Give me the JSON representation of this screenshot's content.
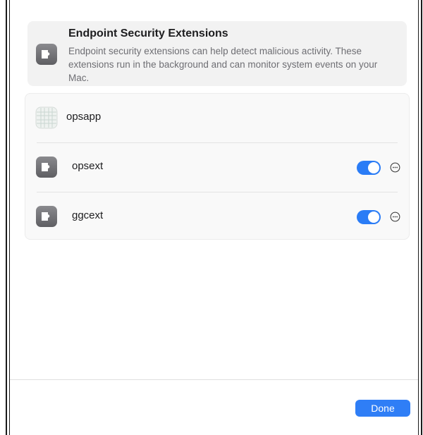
{
  "header": {
    "title": "Endpoint Security Extensions",
    "description": "Endpoint security extensions can help detect malicious activity. These extensions run in the background and can monitor system events on your Mac.",
    "icon": "extension-puzzle-icon"
  },
  "extensions": [
    {
      "label": "opsapp",
      "icon": "app-grid-icon",
      "has_toggle": false
    },
    {
      "label": "opsext",
      "icon": "extension-puzzle-icon",
      "has_toggle": true,
      "enabled": true
    },
    {
      "label": "ggcext",
      "icon": "extension-puzzle-icon",
      "has_toggle": true,
      "enabled": true
    }
  ],
  "footer": {
    "done_label": "Done"
  },
  "colors": {
    "accent": "#2f7ef6",
    "toggle_on": "#2a7cf6"
  }
}
